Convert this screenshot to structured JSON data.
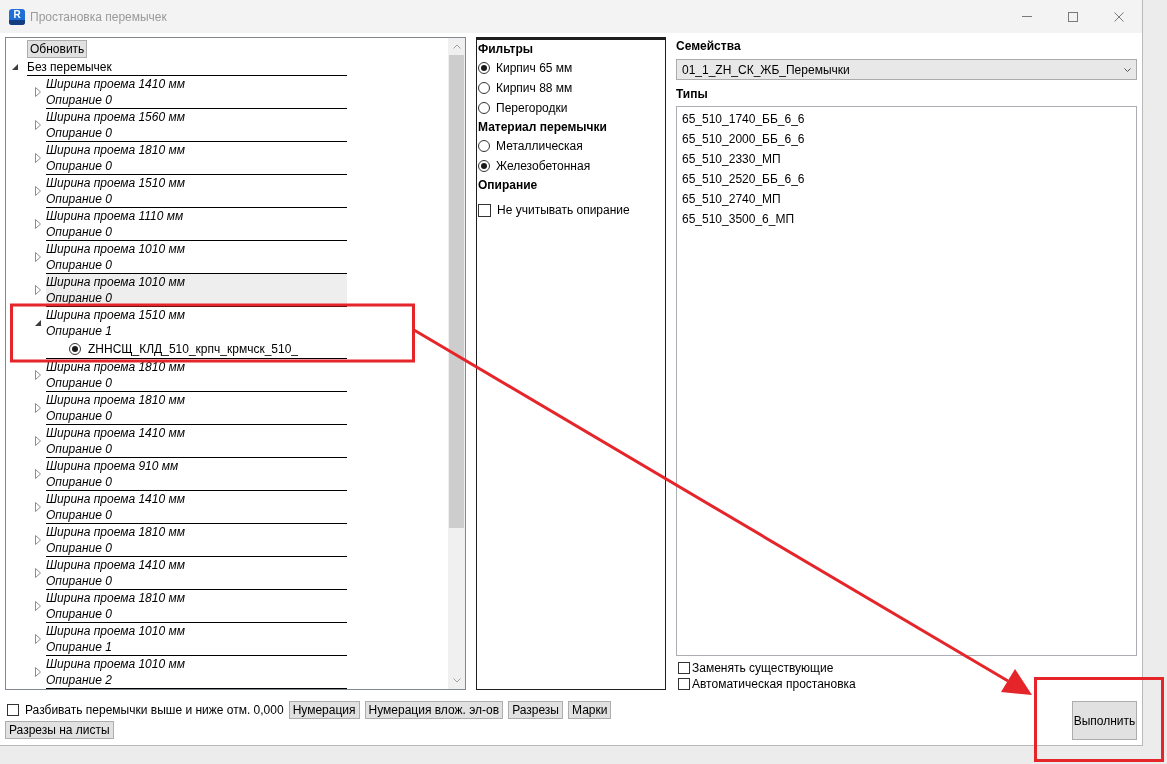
{
  "window": {
    "icon_letter": "R",
    "title": "Простановка перемычек"
  },
  "tree": {
    "refresh_button": "Обновить",
    "root": {
      "label": "Без перемычек",
      "expanded": true,
      "children": [
        {
          "label": "Ширина проема 1410 мм",
          "support": "Опирание 0",
          "expanded": false,
          "highlighted": false
        },
        {
          "label": "Ширина проема 1560 мм",
          "support": "Опирание 0",
          "expanded": false,
          "highlighted": false
        },
        {
          "label": "Ширина проема 1810 мм",
          "support": "Опирание 0",
          "expanded": false,
          "highlighted": false
        },
        {
          "label": "Ширина проема 1510 мм",
          "support": "Опирание 0",
          "expanded": false,
          "highlighted": false
        },
        {
          "label": "Ширина проема 1110 мм",
          "support": "Опирание 0",
          "expanded": false,
          "highlighted": false
        },
        {
          "label": "Ширина проема 1010 мм",
          "support": "Опирание 0",
          "expanded": false,
          "highlighted": false
        },
        {
          "label": "Ширина проема 1010 мм",
          "support": "Опирание 0",
          "expanded": false,
          "highlighted": true
        },
        {
          "label": "Ширина проема 1510 мм",
          "support": "Опирание 1",
          "expanded": true,
          "highlighted": false,
          "children": [
            {
              "label": "ZННСЩ_КЛД_510_крпч_крмчск_510_",
              "selected": true
            }
          ]
        },
        {
          "label": "Ширина проема 1810 мм",
          "support": "Опирание 0",
          "expanded": false,
          "highlighted": false
        },
        {
          "label": "Ширина проема 1810 мм",
          "support": "Опирание 0",
          "expanded": false,
          "highlighted": false
        },
        {
          "label": "Ширина проема 1410 мм",
          "support": "Опирание 0",
          "expanded": false,
          "highlighted": false
        },
        {
          "label": "Ширина проема 910 мм",
          "support": "Опирание 0",
          "expanded": false,
          "highlighted": false
        },
        {
          "label": "Ширина проема 1410 мм",
          "support": "Опирание 0",
          "expanded": false,
          "highlighted": false
        },
        {
          "label": "Ширина проема 1810 мм",
          "support": "Опирание 0",
          "expanded": false,
          "highlighted": false
        },
        {
          "label": "Ширина проема 1410 мм",
          "support": "Опирание 0",
          "expanded": false,
          "highlighted": false
        },
        {
          "label": "Ширина проема 1810 мм",
          "support": "Опирание 0",
          "expanded": false,
          "highlighted": false
        },
        {
          "label": "Ширина проема 1010 мм",
          "support": "Опирание 1",
          "expanded": false,
          "highlighted": false
        },
        {
          "label": "Ширина проема 1010 мм",
          "support": "Опирание 2",
          "expanded": false,
          "highlighted": false
        }
      ]
    }
  },
  "filters": {
    "sections": [
      {
        "title": "Фильтры",
        "options": [
          {
            "kind": "radio",
            "label": "Кирпич 65 мм",
            "selected": true
          },
          {
            "kind": "radio",
            "label": "Кирпич 88 мм",
            "selected": false
          },
          {
            "kind": "radio",
            "label": "Перегородки",
            "selected": false
          }
        ]
      },
      {
        "title": "Материал перемычки",
        "options": [
          {
            "kind": "radio",
            "label": "Металлическая",
            "selected": false
          },
          {
            "kind": "radio",
            "label": "Железобетонная",
            "selected": true
          }
        ]
      },
      {
        "title": "Опирание",
        "options": [
          {
            "kind": "checkbox",
            "label": "Не учитывать опирание",
            "checked": false
          }
        ]
      }
    ]
  },
  "families": {
    "label": "Семейства",
    "value": "01_1_ZH_СК_ЖБ_Перемычки"
  },
  "types": {
    "label": "Типы",
    "items": [
      {
        "label": "65_510_1740_ББ_6_6",
        "selected": false
      },
      {
        "label": "65_510_2000_ББ_6_6",
        "selected": false
      },
      {
        "label": "65_510_2330_МП",
        "selected": false
      },
      {
        "label": "65_510_2520_ББ_6_6",
        "selected": false
      },
      {
        "label": "65_510_2740_МП",
        "selected": false
      },
      {
        "label": "65_510_3500_6_МП",
        "selected": false
      }
    ]
  },
  "options": [
    {
      "label": "Заменять существующие",
      "checked": false
    },
    {
      "label": "Автоматическая простановка",
      "checked": false
    }
  ],
  "bottom_bar": {
    "split_checkbox": {
      "label": "Разбивать перемычки выше и ниже отм. 0,000",
      "checked": false
    },
    "buttons": [
      "Нумерация",
      "Нумерация влож. эл-ов",
      "Разрезы",
      "Марки",
      "Разрезы на листы"
    ]
  },
  "run_button": "Выполнить"
}
